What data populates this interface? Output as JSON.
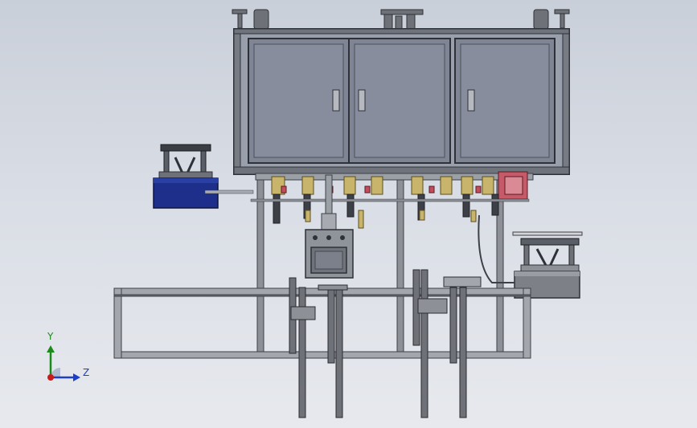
{
  "viewport": {
    "background_top": "#c9cfd9",
    "background_bottom": "#e7e9ee"
  },
  "triad": {
    "y_label": "Y",
    "z_label": "Z",
    "y_color": "#1a8c1a",
    "z_color": "#1d3fc8",
    "x_color": "#cc1a1a"
  },
  "colors": {
    "frame": "#8d9096",
    "frame_dark": "#3d4046",
    "cabinet_panel": "#7f8595",
    "cabinet_border": "#2e3138",
    "blue_hopper": "#1d2f8a",
    "brass": "#c8b46a",
    "red_part": "#c44d5c",
    "gray_drum": "#7e8088"
  }
}
